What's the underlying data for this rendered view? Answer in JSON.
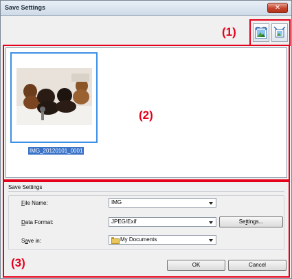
{
  "window": {
    "title": "Save Settings",
    "close_glyph": "✕"
  },
  "annotations": {
    "tag1": "(1)",
    "tag2": "(2)",
    "tag3": "(3)"
  },
  "toolbar": {
    "buttons": [
      {
        "icon": "enlarge-thumbnail-icon"
      },
      {
        "icon": "reduce-thumbnail-icon"
      }
    ]
  },
  "thumbnails": [
    {
      "label": "IMG_20120101_0001"
    }
  ],
  "settings": {
    "group_title": "Save Settings",
    "file_name": {
      "label_underlined": "F",
      "label_rest": "ile Name:",
      "value": "IMG"
    },
    "data_format": {
      "label_underlined": "D",
      "label_rest": "ata Format:",
      "value": "JPEG/Exif",
      "settings_button_pre": "Se",
      "settings_button_ul": "t",
      "settings_button_post": "tings..."
    },
    "save_in": {
      "label_pre": "S",
      "label_underlined": "a",
      "label_rest": "ve in:",
      "value": "My Documents"
    }
  },
  "actions": {
    "ok_label": "OK",
    "cancel_label": "Cancel"
  },
  "colors": {
    "annotation_red": "#e4001b",
    "selection_blue": "#3a73c8"
  }
}
